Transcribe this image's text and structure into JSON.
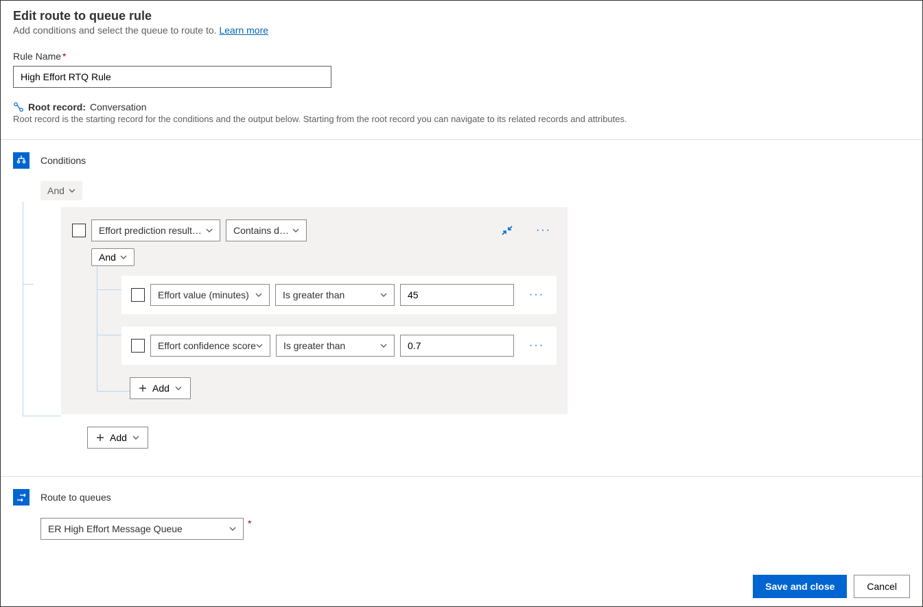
{
  "header": {
    "title": "Edit route to queue rule",
    "subtitle_pre": "Add conditions and select the queue to route to. ",
    "learn_more": "Learn more"
  },
  "ruleName": {
    "label": "Rule Name",
    "value": "High Effort RTQ Rule"
  },
  "rootRecord": {
    "label": "Root record:",
    "value": "Conversation",
    "description": "Root record is the starting record for the conditions and the output below. Starting from the root record you can navigate to its related records and attributes."
  },
  "conditions": {
    "section_title": "Conditions",
    "top_operator": "And",
    "group": {
      "entity": "Effort prediction result…",
      "entity_operator": "Contains data",
      "inner_operator": "And",
      "rows": [
        {
          "attribute": "Effort value (minutes)",
          "operator": "Is greater than",
          "value": "45"
        },
        {
          "attribute": "Effort confidence score",
          "operator": "Is greater than",
          "value": "0.7"
        }
      ],
      "add_label": "Add"
    },
    "outer_add_label": "Add"
  },
  "route": {
    "section_title": "Route to queues",
    "selected_queue": "ER High Effort Message Queue"
  },
  "footer": {
    "save": "Save and close",
    "cancel": "Cancel"
  }
}
